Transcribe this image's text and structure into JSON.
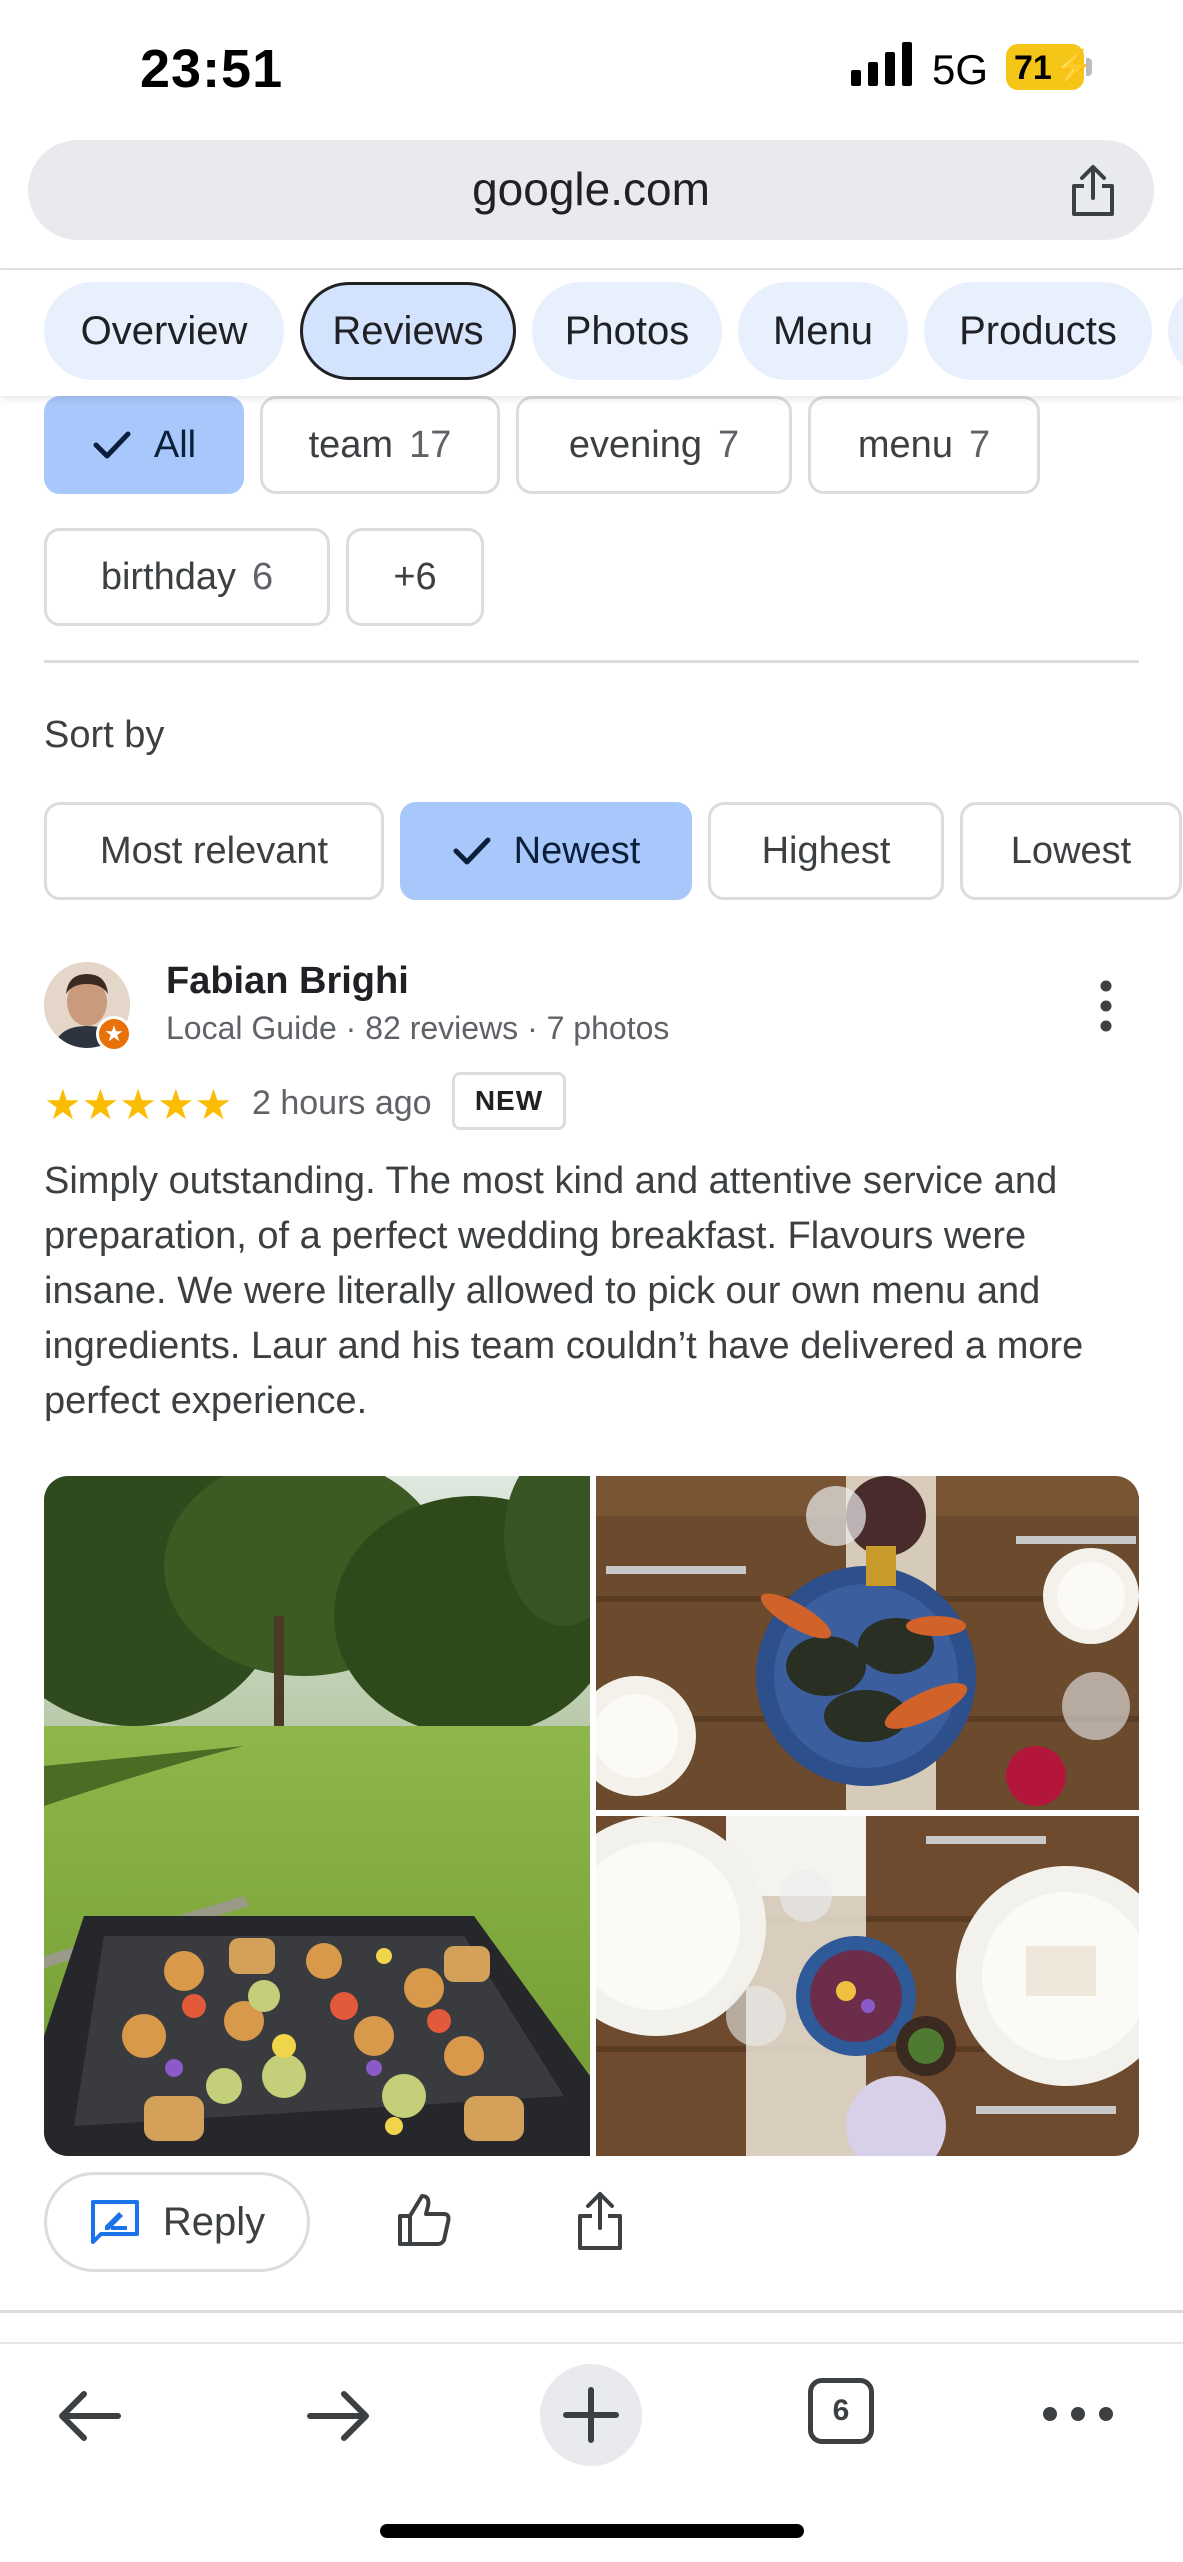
{
  "status_bar": {
    "time": "23:51",
    "network": "5G",
    "battery": "71"
  },
  "url_bar": {
    "url": "google.com"
  },
  "tabs": [
    {
      "label": "Overview",
      "active": false
    },
    {
      "label": "Reviews",
      "active": true
    },
    {
      "label": "Photos",
      "active": false
    },
    {
      "label": "Menu",
      "active": false
    },
    {
      "label": "Products",
      "active": false
    }
  ],
  "filter_chips": [
    {
      "label": "All",
      "count": "",
      "selected": true
    },
    {
      "label": "team",
      "count": "17",
      "selected": false
    },
    {
      "label": "evening",
      "count": "7",
      "selected": false
    },
    {
      "label": "menu",
      "count": "7",
      "selected": false
    },
    {
      "label": "birthday",
      "count": "6",
      "selected": false
    },
    {
      "label": "+6",
      "count": "",
      "selected": false
    }
  ],
  "sort": {
    "label": "Sort by",
    "options": [
      {
        "label": "Most relevant",
        "selected": false
      },
      {
        "label": "Newest",
        "selected": true
      },
      {
        "label": "Highest",
        "selected": false
      },
      {
        "label": "Lowest",
        "selected": false
      }
    ]
  },
  "review": {
    "name": "Fabian Brighi",
    "meta": "Local Guide · 82 reviews · 7 photos",
    "rating": 5,
    "stars": "★★★★★",
    "time": "2 hours ago",
    "badge": "NEW",
    "text": "Simply outstanding. The most kind and attentive service and preparation, of a perfect wedding breakfast. Flavours were insane. We were literally allowed to pick our own menu and ingredients. Laur and his team couldn’t have delivered a more perfect experience.",
    "actions": {
      "reply_label": "Reply"
    }
  },
  "toolbar": {
    "tab_count": "6"
  },
  "colors": {
    "accent": "#a8c7fa",
    "tab_bg": "#e8f0fe",
    "star": "#fbbc04",
    "badge_orange": "#e8710a"
  }
}
